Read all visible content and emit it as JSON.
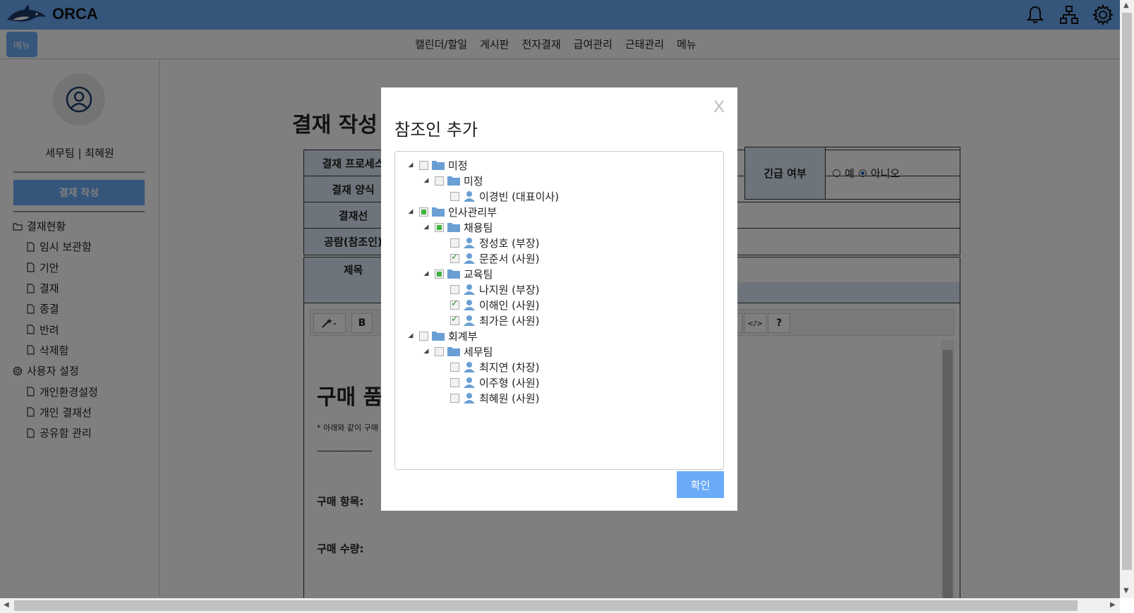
{
  "app": {
    "logo_text": "ORCA"
  },
  "navbar": {
    "menu_button": "메뉴",
    "items": [
      "캘린더/할일",
      "게시판",
      "전자결재",
      "급여관리",
      "근태관리",
      "메뉴"
    ]
  },
  "sidebar": {
    "user": "세무팀 | 최혜원",
    "write_button": "결재 작성",
    "sections": [
      {
        "label": "결재현황",
        "icon": "folder-icon"
      },
      {
        "label": "임시 보관함"
      },
      {
        "label": "기안"
      },
      {
        "label": "결재"
      },
      {
        "label": "종결"
      },
      {
        "label": "반려"
      },
      {
        "label": "삭제함"
      },
      {
        "label": "사용자 설정",
        "icon": "gear-icon"
      },
      {
        "label": "개인환경설정"
      },
      {
        "label": "개인 결재선"
      },
      {
        "label": "공유함 관리"
      }
    ]
  },
  "main": {
    "page_title": "결재 작성",
    "form_labels": [
      "결재 프로세스",
      "결재 양식",
      "결재선",
      "공람(참조인)"
    ],
    "urgent_label": "긴급 여부",
    "urgent_options": [
      "예",
      "아니오"
    ],
    "urgent_selected": "아니오",
    "title_label": "제목",
    "editor": {
      "doc_title": "구매 품",
      "note": "* 아래와 같이 구매",
      "dashes": "---------------------",
      "line1": "구매 항목:",
      "line2": "구매 수량:"
    }
  },
  "modal": {
    "title": "참조인 추가",
    "close": "X",
    "confirm": "확인",
    "tree": [
      {
        "label": "미정",
        "type": "folder",
        "depth": 0,
        "state": "none",
        "expanded": true
      },
      {
        "label": "미정",
        "type": "folder",
        "depth": 1,
        "state": "none",
        "expanded": true
      },
      {
        "label": "이경빈 (대표이사)",
        "type": "person",
        "depth": 2,
        "state": "none"
      },
      {
        "label": "인사관리부",
        "type": "folder",
        "depth": 0,
        "state": "half",
        "expanded": true
      },
      {
        "label": "채용팀",
        "type": "folder",
        "depth": 1,
        "state": "half",
        "expanded": true
      },
      {
        "label": "정성호 (부장)",
        "type": "person",
        "depth": 2,
        "state": "none"
      },
      {
        "label": "문준서 (사원)",
        "type": "person",
        "depth": 2,
        "state": "checked"
      },
      {
        "label": "교육팀",
        "type": "folder",
        "depth": 1,
        "state": "half",
        "expanded": true
      },
      {
        "label": "나지원 (부장)",
        "type": "person",
        "depth": 2,
        "state": "none"
      },
      {
        "label": "이해인 (사원)",
        "type": "person",
        "depth": 2,
        "state": "checked"
      },
      {
        "label": "최가은 (사원)",
        "type": "person",
        "depth": 2,
        "state": "checked"
      },
      {
        "label": "회계부",
        "type": "folder",
        "depth": 0,
        "state": "none",
        "expanded": true
      },
      {
        "label": "세무팀",
        "type": "folder",
        "depth": 1,
        "state": "none",
        "expanded": true
      },
      {
        "label": "최지연 (차장)",
        "type": "person",
        "depth": 2,
        "state": "none"
      },
      {
        "label": "이주형 (사원)",
        "type": "person",
        "depth": 2,
        "state": "none"
      },
      {
        "label": "최혜원 (사원)",
        "type": "person",
        "depth": 2,
        "state": "none"
      }
    ]
  },
  "colors": {
    "accent": "#6aaaf7",
    "label_bg": "#dce8f7",
    "check_green": "#3db53d"
  }
}
